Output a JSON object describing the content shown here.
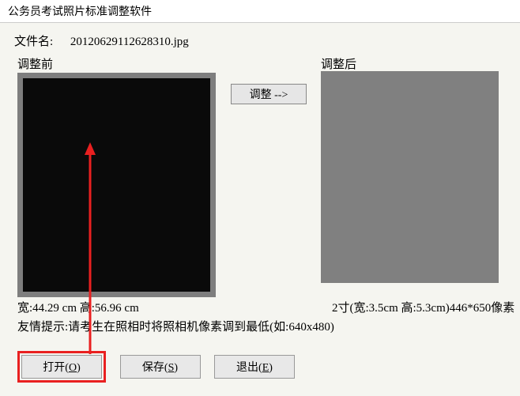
{
  "window": {
    "title": "公务员考试照片标准调整软件"
  },
  "filename": {
    "label": "文件名:",
    "value": "20120629112628310.jpg"
  },
  "headings": {
    "before": "调整前",
    "after": "调整后"
  },
  "buttons": {
    "adjust": "调整 -->",
    "open_prefix": "打开(",
    "open_key": "O",
    "open_suffix": ")",
    "save_prefix": "保存(",
    "save_key": "S",
    "save_suffix": ")",
    "exit_prefix": "退出(",
    "exit_key": "E",
    "exit_suffix": ")"
  },
  "dimensions": {
    "left": "宽:44.29 cm 高:56.96 cm",
    "right": "2寸(宽:3.5cm 高:5.3cm)446*650像素"
  },
  "hint": "友情提示:请考生在照相时将照相机像素调到最低(如:640x480)",
  "colors": {
    "annotation_red": "#e92020"
  }
}
